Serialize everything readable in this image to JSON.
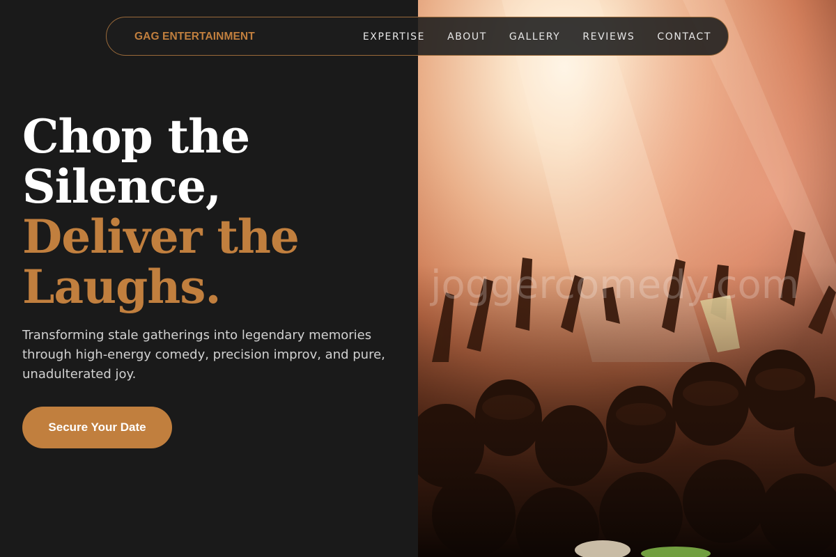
{
  "brand": {
    "name": "GAG ENTERTAINMENT",
    "color": "#c17f3e"
  },
  "nav": {
    "items": [
      {
        "label": "EXPERTISE"
      },
      {
        "label": "ABOUT"
      },
      {
        "label": "GALLERY"
      },
      {
        "label": "REVIEWS"
      },
      {
        "label": "CONTACT"
      }
    ]
  },
  "hero": {
    "headline_white_1": "Chop the",
    "headline_white_2": "Silence,",
    "headline_gold_1": "Deliver the",
    "headline_gold_2": "Laughs.",
    "subtext": "Transforming stale gatherings into legendary memories through high-energy comedy, precision improv, and pure, unadulterated joy.",
    "cta_label": "Secure Your Date",
    "image_watermark": "joggercomedy.com"
  },
  "colors": {
    "background": "#1a1a1a",
    "accent": "#c17f3e",
    "text": "#ffffff",
    "muted_text": "#d2d2d2"
  }
}
